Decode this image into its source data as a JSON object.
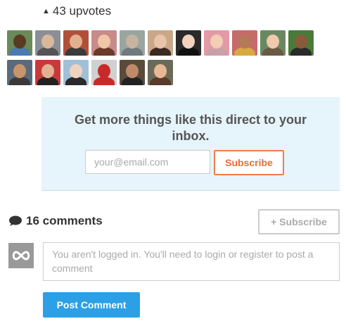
{
  "upvotes": {
    "arrow_icon": "upvote-arrow-icon",
    "label": "43 upvotes"
  },
  "avatars": {
    "row1": [
      {
        "bg": "#6b8a5a",
        "skin": "#5a3a22",
        "shirt": "#4a7bb0"
      },
      {
        "bg": "#8a8f95",
        "skin": "#d9b89a",
        "shirt": "#555"
      },
      {
        "bg": "#b0503a",
        "skin": "#e2b08e",
        "shirt": "#3a3a3a"
      },
      {
        "bg": "#c88a8a",
        "skin": "#f0c7a6",
        "shirt": "#6a3a2a"
      },
      {
        "bg": "#9aa5a0",
        "skin": "#c7b3a0",
        "shirt": "#707a80"
      },
      {
        "bg": "#c8a888",
        "skin": "#e8c4a8",
        "shirt": "#3a2a22"
      },
      {
        "bg": "#2a2a2a",
        "skin": "#f2d2bc",
        "shirt": "#111"
      },
      {
        "bg": "#e39aa4",
        "skin": "#f3cdb4",
        "shirt": "#caa0a8"
      },
      {
        "bg": "#c76a6a",
        "skin": "#b47a58",
        "shirt": "#d9a840"
      },
      {
        "bg": "#6a8860",
        "skin": "#f0c8ac",
        "shirt": "#6a5a44"
      },
      {
        "bg": "#4a7a3a",
        "skin": "#8a5a3a",
        "shirt": "#2a2a2a"
      }
    ],
    "row2": [
      {
        "bg": "#5a6a7a",
        "skin": "#c8946a",
        "shirt": "#3a3a3a"
      },
      {
        "bg": "#c83a3a",
        "skin": "#e4b094",
        "shirt": "#222"
      },
      {
        "bg": "#a0c0d8",
        "skin": "#f0d2c0",
        "shirt": "#2a2a2a"
      },
      {
        "bg": "#d0d0d0",
        "skin": "#c82a2a",
        "shirt": "#c82a2a"
      },
      {
        "bg": "#5a4a3a",
        "skin": "#c08a6a",
        "shirt": "#222"
      },
      {
        "bg": "#6a6a5a",
        "skin": "#e8b894",
        "shirt": "#5a3a2a"
      }
    ]
  },
  "promo": {
    "title": "Get more things like this direct to your inbox.",
    "email_placeholder": "your@email.com",
    "subscribe_label": "Subscribe",
    "accent_color": "#ef6b3a"
  },
  "comments": {
    "icon": "speech-bubble-icon",
    "label": "16 comments",
    "subscribe_label": "+ Subscribe",
    "avatar_icon": "infinity-icon",
    "textarea_placeholder": "You aren't logged in. You'll need to login or register to post a comment",
    "post_label": "Post Comment",
    "post_color": "#2ba0e6"
  }
}
